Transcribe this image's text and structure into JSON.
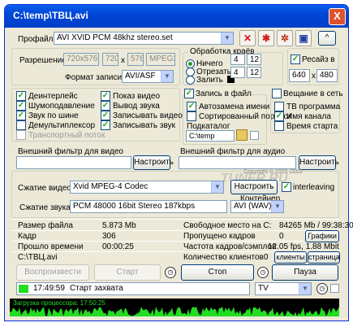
{
  "window": {
    "title": "C:\\temp\\ТВЦ.avi",
    "close": "X"
  },
  "profile": {
    "label": "Профайл",
    "value": "AVI XVID PCM 48khz stereo.set",
    "up_btn": "^"
  },
  "resolution": {
    "label": "Разрешение",
    "preset": "720x576",
    "width": "720",
    "x": "x",
    "height": "576",
    "format": "MPEG2"
  },
  "record_format": {
    "label": "Формат записи",
    "value": "AVI/ASF"
  },
  "edges": {
    "title": "Обработка краёв",
    "options": [
      "Ничего",
      "Отрезать",
      "Залить"
    ],
    "selected": 0,
    "values": [
      "4",
      "12",
      "4",
      "12"
    ]
  },
  "resize": {
    "label": "Ресайз в",
    "w": "640",
    "x": "x",
    "h": "480",
    "checked": true
  },
  "options_left": [
    {
      "label": "Деинтерлейс",
      "checked": true
    },
    {
      "label": "Шумоподавление",
      "checked": true
    },
    {
      "label": "Звук по шине",
      "checked": true
    },
    {
      "label": "Демультиплексор",
      "checked": false
    },
    {
      "label": "Транспортный поток",
      "checked": false,
      "disabled": true
    }
  ],
  "options_mid": [
    {
      "label": "Показ видео",
      "checked": true
    },
    {
      "label": "Вывод звука",
      "checked": true
    },
    {
      "label": "Записывать видео",
      "checked": true
    },
    {
      "label": "Записывать звук",
      "checked": true
    }
  ],
  "file_record": {
    "label": "Запись в файл",
    "checked": true
  },
  "net_record": {
    "label": "Вещание в сеть",
    "checked": false
  },
  "auto_name": {
    "label": "Автозамена имени",
    "checked": true
  },
  "sorted_order": {
    "label": "Сортированный порядок",
    "checked": false
  },
  "subdir": {
    "label": "Подкаталог",
    "value": "C:\\temp"
  },
  "tv_program": {
    "label": "ТВ программа",
    "checked": false
  },
  "channel_name": {
    "label": "Имя канала",
    "checked": true
  },
  "start_time": {
    "label": "Время старта",
    "checked": false
  },
  "video_filter": {
    "label": "Внешний фильтр для видео",
    "button": "Настроить"
  },
  "audio_filter": {
    "label": "Внешний фильтр для аудио",
    "button": "Настроить"
  },
  "watermark": {
    "brand": "TUNER.RU",
    "copy": "Copyright © 1999-2009"
  },
  "video_codec": {
    "label": "Сжатие видео",
    "value": "Xvid MPEG-4 Codec",
    "button": "Настроить",
    "interleaving": "interleaving",
    "interleaving_checked": true
  },
  "audio_codec": {
    "label": "Сжатие звука",
    "value": "PCM  48000 16bit Stereo 187kbps",
    "container_label": "Контейнер",
    "container_value": "AVI (WAV)"
  },
  "stats": {
    "file_size": {
      "label": "Размер файла",
      "value": "5.873 Mb"
    },
    "free_space": {
      "label": "Свободное место на C:",
      "value": "84265 Mb / 99:38:30"
    },
    "frame": {
      "label": "Кадр",
      "value": "306"
    },
    "dropped": {
      "label": "Пропущено кадров",
      "value": "0"
    },
    "graphics_btn": "Графики",
    "elapsed": {
      "label": "Прошло времени",
      "value": "00:00:25"
    },
    "rate": {
      "label": "Частота кадров/сэмплов",
      "value": "12.05 fps, 1.88 Mbit"
    },
    "path": "C:\\ТВЦ.avi",
    "clients": {
      "label": "Количество клиентов",
      "value": "0"
    },
    "clients_btn": "клиенты",
    "page_btn": "страница"
  },
  "controls": {
    "play": "Воспроизвести",
    "start": "Старт",
    "stop": "Стоп",
    "pause": "Пауза"
  },
  "status": {
    "time": "17:49:59",
    "text": "Старт захвата",
    "source": "TV"
  },
  "cpu": {
    "label": "Загрузка процессора: 17:50:25",
    "color": "#22dd22"
  }
}
